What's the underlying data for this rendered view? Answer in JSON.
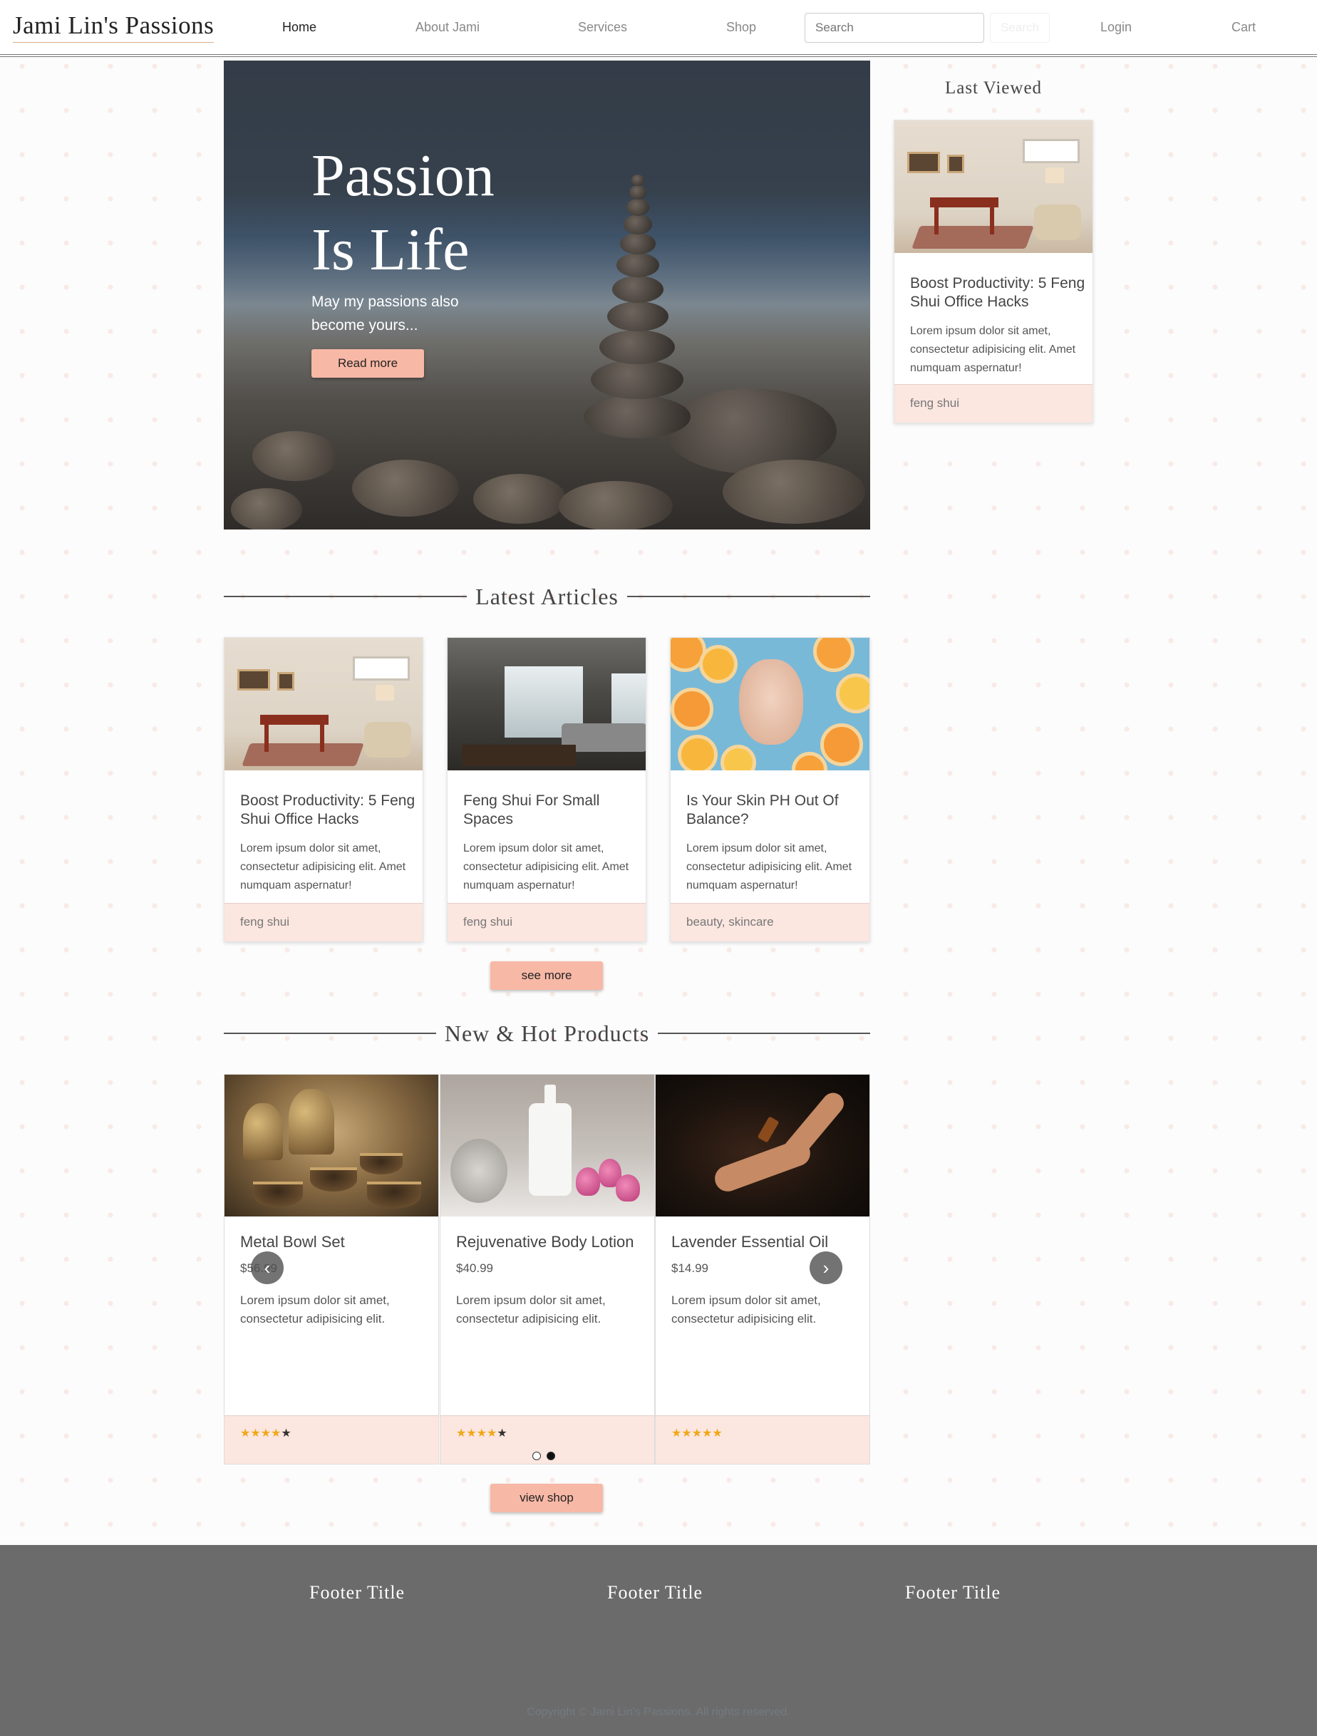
{
  "brand": "Jami Lin's Passions",
  "nav": {
    "items": [
      "Home",
      "About Jami",
      "Services",
      "Shop"
    ],
    "search_placeholder": "Search",
    "search_button": "Search",
    "login": "Login",
    "cart": "Cart"
  },
  "hero": {
    "title_line1": "Passion",
    "title_line2": "Is Life",
    "subtitle": "May my passions also become yours...",
    "button": "Read more"
  },
  "articles": {
    "heading": "Latest Articles",
    "items": [
      {
        "title": "Boost Productivity: 5 Feng Shui Office Hacks",
        "text": "Lorem ipsum dolor sit amet, consectetur adipisicing elit. Amet numquam aspernatur!",
        "tags": "feng shui"
      },
      {
        "title": "Feng Shui For Small Spaces",
        "text": "Lorem ipsum dolor sit amet, consectetur adipisicing elit. Amet numquam aspernatur!",
        "tags": "feng shui"
      },
      {
        "title": "Is Your Skin PH Out Of Balance?",
        "text": "Lorem ipsum dolor sit amet, consectetur adipisicing elit. Amet numquam aspernatur!",
        "tags": "beauty, skincare"
      }
    ],
    "see_more": "see more"
  },
  "products": {
    "heading": "New & Hot Products",
    "items": [
      {
        "title": "Metal Bowl Set",
        "price": "$56.99",
        "text": "Lorem ipsum dolor sit amet, consectetur adipisicing elit.",
        "rating": 4
      },
      {
        "title": "Rejuvenative Body Lotion",
        "price": "$40.99",
        "text": "Lorem ipsum dolor sit amet, consectetur adipisicing elit.",
        "rating": 4
      },
      {
        "title": "Lavender Essential Oil",
        "price": "$14.99",
        "text": "Lorem ipsum dolor sit amet, consectetur adipisicing elit.",
        "rating": 5
      }
    ],
    "carousel_page": 2,
    "carousel_pages": 2,
    "view_shop": "view shop"
  },
  "sidebar": {
    "heading": "Last Viewed",
    "item": {
      "title": "Boost Productivity: 5 Feng Shui Office Hacks",
      "text": "Lorem ipsum dolor sit amet, consectetur adipisicing elit. Amet numquam aspernatur!",
      "tags": "feng shui"
    }
  },
  "footer": {
    "titles": [
      "Footer Title",
      "Footer Title",
      "Footer Title"
    ],
    "copyright": "Copyright © Jami Lin's Passions. All rights reserved."
  },
  "colors": {
    "accent": "#f8b8a6",
    "card_footer": "#fbe6e0",
    "footer_bg": "#6b6b6b",
    "star": "#f0a818"
  }
}
